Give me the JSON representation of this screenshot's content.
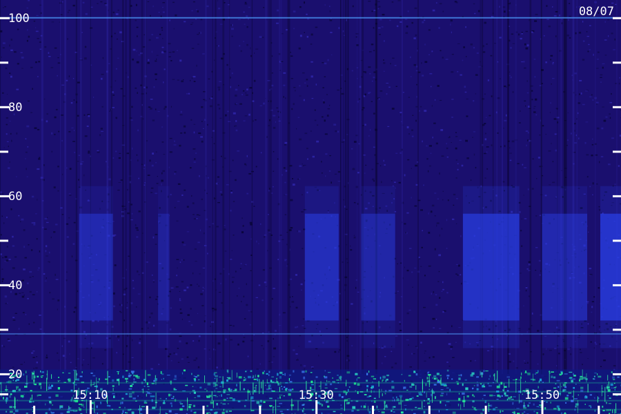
{
  "chart_data": {
    "type": "heatmap",
    "date_label": "08/07",
    "y_axis": {
      "ylim": [
        11,
        104
      ],
      "major_ticks": [
        20,
        40,
        60,
        80,
        100
      ],
      "minor_ticks": [
        30,
        50,
        70,
        90
      ],
      "tick_labels": [
        "20",
        "40",
        "60",
        "80",
        "100"
      ]
    },
    "x_axis": {
      "xlim": [
        "15:02",
        "15:57"
      ],
      "major_ticks": [
        "15:10",
        "15:30",
        "15:50"
      ],
      "minor_ticks": [
        "15:05",
        "15:15",
        "15:20",
        "15:25",
        "15:35",
        "15:40",
        "15:45",
        "15:55"
      ],
      "tick_labels": [
        "15:10",
        "15:30",
        "15:50"
      ]
    },
    "colors": {
      "background": "#1a0f6e",
      "low": "#0b0640",
      "mid": "#2a40e8",
      "high": "#20e890",
      "axis": "#ffffff"
    },
    "bright_bands": [
      {
        "start": "15:09",
        "end": "15:12",
        "y_range": [
          32,
          56
        ],
        "level": 0.45
      },
      {
        "start": "15:16",
        "end": "15:17",
        "y_range": [
          32,
          56
        ],
        "level": 0.3
      },
      {
        "start": "15:29",
        "end": "15:32",
        "y_range": [
          32,
          56
        ],
        "level": 0.55
      },
      {
        "start": "15:34",
        "end": "15:37",
        "y_range": [
          32,
          56
        ],
        "level": 0.4
      },
      {
        "start": "15:43",
        "end": "15:48",
        "y_range": [
          32,
          56
        ],
        "level": 0.65
      },
      {
        "start": "15:50",
        "end": "15:54",
        "y_range": [
          32,
          56
        ],
        "level": 0.45
      },
      {
        "start": "15:57",
        "end": "15:57",
        "y_range": [
          32,
          56
        ],
        "level": 0.7
      }
    ],
    "horizontal_lines": [
      {
        "y": 100,
        "level": 0.7
      },
      {
        "y": 29,
        "level": 0.5
      },
      {
        "y": 18,
        "level": 0.8
      },
      {
        "y": 16,
        "level": 0.9
      },
      {
        "y": 14,
        "level": 0.9
      },
      {
        "y": 12,
        "level": 0.8
      }
    ]
  }
}
